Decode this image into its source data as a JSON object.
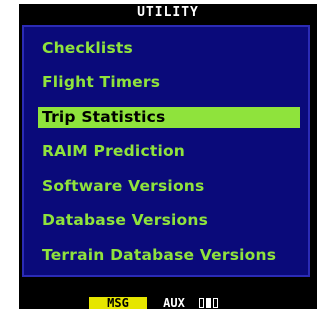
{
  "window": {
    "title": "UTILITY"
  },
  "menu": {
    "items": [
      {
        "label": "Checklists",
        "selected": false
      },
      {
        "label": "Flight Timers",
        "selected": false
      },
      {
        "label": "Trip Statistics",
        "selected": true
      },
      {
        "label": "RAIM Prediction",
        "selected": false
      },
      {
        "label": "Software Versions",
        "selected": false
      },
      {
        "label": "Database Versions",
        "selected": false
      },
      {
        "label": "Terrain Database Versions",
        "selected": false
      }
    ]
  },
  "status_bar": {
    "msg_label": "MSG",
    "aux_label": "AUX",
    "page_indicator_icon": "page-position-boxes"
  },
  "colors": {
    "menu_background": "#0a0a7a",
    "menu_text": "#8fe33c",
    "selection_highlight": "#8fe33c",
    "msg_highlight": "#e6e600"
  }
}
